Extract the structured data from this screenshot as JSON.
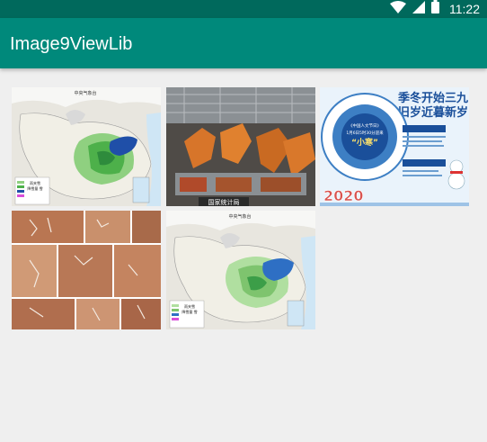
{
  "status_bar": {
    "time": "11:22",
    "icons": [
      "wifi-icon",
      "cell-signal-icon",
      "battery-icon"
    ]
  },
  "app_bar": {
    "title": "Image9ViewLib",
    "color": "#00897b",
    "status_color": "#00695c"
  },
  "grid": {
    "images": [
      {
        "name": "weather-map",
        "texts": {
          "header": "中央气象台",
          "legend_title": "雨夹雪",
          "legend_sub": "降雪量 雪"
        }
      },
      {
        "name": "factory-robots",
        "texts": {
          "watermark": "国家统计局"
        }
      },
      {
        "name": "winter-poster",
        "texts": {
          "headline1": "季冬开始三九",
          "headline2": "旧岁近暮新岁",
          "center1": "《中国人文节日》",
          "center2": "1月6日5时30分迎来",
          "center3": "“小寒”",
          "year": "2020"
        }
      },
      {
        "name": "rock-paintings",
        "texts": {}
      },
      {
        "name": "weather-map-2",
        "texts": {
          "header": "中央气象台",
          "legend_title": "雨夹雪",
          "legend_sub": "降雪量 雪"
        }
      }
    ]
  }
}
